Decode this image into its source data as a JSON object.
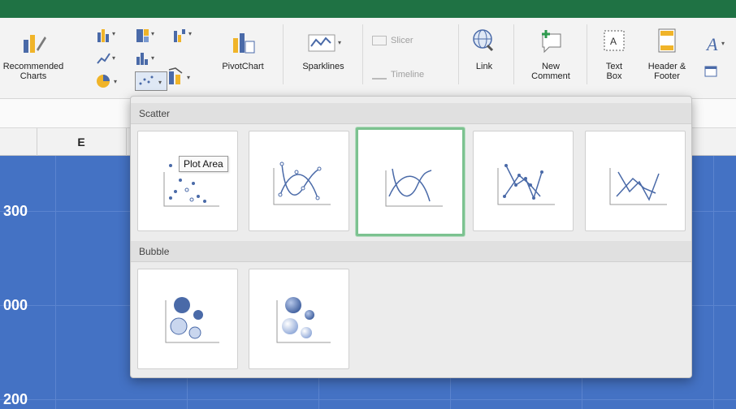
{
  "ribbon": {
    "recommended_charts": "Recommended\nCharts",
    "pivotchart": "PivotChart",
    "sparklines": "Sparklines",
    "slicer": "Slicer",
    "timeline": "Timeline",
    "link": "Link",
    "new_comment": "New\nComment",
    "text_box": "Text\nBox",
    "header_footer": "Header &\nFooter"
  },
  "sheet": {
    "column_e": "E",
    "y_labels": [
      "300",
      "000",
      "200"
    ]
  },
  "gallery": {
    "scatter_label": "Scatter",
    "bubble_label": "Bubble",
    "tooltip": "Plot Area",
    "scatter_tiles": [
      "scatter-markers",
      "scatter-smooth-lines-markers",
      "scatter-smooth-lines",
      "scatter-straight-lines-markers",
      "scatter-straight-lines"
    ],
    "bubble_tiles": [
      "bubble",
      "bubble-3d"
    ]
  },
  "colors": {
    "title_bar": "#1f7244",
    "plot_fill": "#4472c4",
    "selection": "#7cc290",
    "chart_icon_blue": "#4a6aa8"
  }
}
